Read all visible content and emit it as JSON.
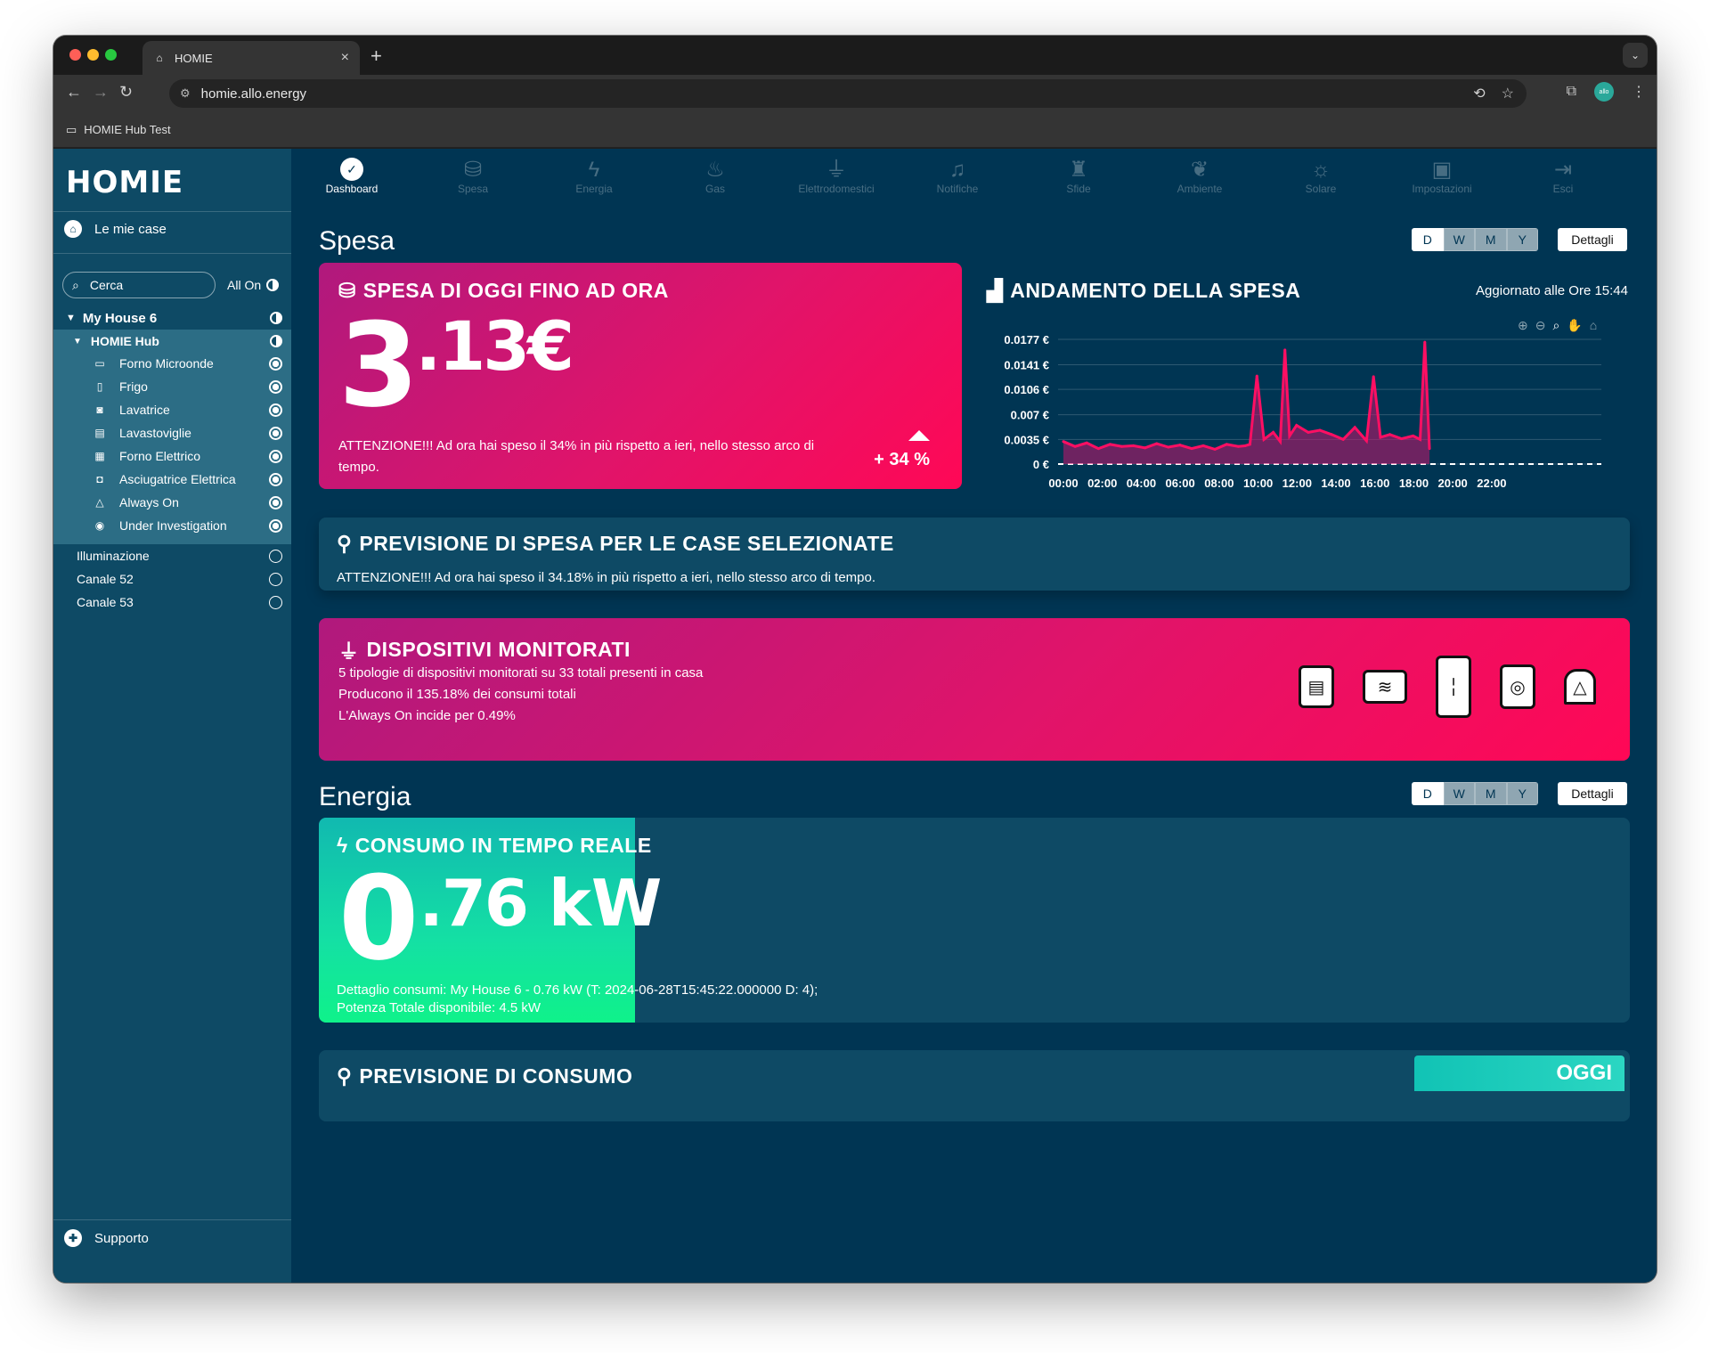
{
  "browser": {
    "tab_title": "HOMIE",
    "url": "homie.allo.energy",
    "bookmark": "HOMIE Hub Test",
    "avatar_text": "allo"
  },
  "sidebar": {
    "logo": "HOMIE",
    "home_label": "Le mie case",
    "search_placeholder": "Cerca",
    "all_on": "All On",
    "house": "My House 6",
    "hub": "HOMIE Hub",
    "devices": [
      {
        "label": "Forno Microonde",
        "icon": "microwave-icon"
      },
      {
        "label": "Frigo",
        "icon": "fridge-icon"
      },
      {
        "label": "Lavatrice",
        "icon": "washer-icon"
      },
      {
        "label": "Lavastoviglie",
        "icon": "dishwasher-icon"
      },
      {
        "label": "Forno Elettrico",
        "icon": "oven-icon"
      },
      {
        "label": "Asciugatrice Elettrica",
        "icon": "dryer-icon"
      },
      {
        "label": "Always On",
        "icon": "always-on-icon"
      },
      {
        "label": "Under Investigation",
        "icon": "eye-icon"
      }
    ],
    "channels": [
      "Illuminazione",
      "Canale 52",
      "Canale 53"
    ],
    "support": "Supporto"
  },
  "nav": [
    {
      "label": "Dashboard",
      "icon": "dashboard-icon"
    },
    {
      "label": "Spesa",
      "icon": "coins-icon"
    },
    {
      "label": "Energia",
      "icon": "bolt-icon"
    },
    {
      "label": "Gas",
      "icon": "flame-icon"
    },
    {
      "label": "Elettrodomestici",
      "icon": "plug-icon"
    },
    {
      "label": "Notifiche",
      "icon": "bell-icon"
    },
    {
      "label": "Sfide",
      "icon": "trophy-icon"
    },
    {
      "label": "Ambiente",
      "icon": "leaf-icon"
    },
    {
      "label": "Solare",
      "icon": "sun-icon"
    },
    {
      "label": "Impostazioni",
      "icon": "user-settings-icon"
    },
    {
      "label": "Esci",
      "icon": "logout-icon"
    }
  ],
  "periods": [
    "D",
    "W",
    "M",
    "Y"
  ],
  "dettagli": "Dettagli",
  "spesa": {
    "title": "Spesa",
    "today_card": {
      "title": "SPESA DI OGGI FINO AD ORA",
      "value_int": "3",
      "value_dec": ".13€",
      "warning": "ATTENZIONE!!! Ad ora hai speso il 34% in più rispetto a ieri, nello stesso arco di tempo.",
      "delta": "+ 34 %"
    },
    "trend": {
      "title": "ANDAMENTO DELLA SPESA",
      "updated": "Aggiornato alle Ore 15:44"
    },
    "forecast": {
      "title": "PREVISIONE DI SPESA PER LE CASE SELEZIONATE",
      "text": "ATTENZIONE!!! Ad ora hai speso il 34.18% in più rispetto a ieri, nello stesso arco di tempo."
    },
    "devices_card": {
      "title": "DISPOSITIVI MONITORATI",
      "lines": [
        "5 tipologie di dispositivi monitorati su 33 totali presenti in casa",
        "Producono il 135.18% dei consumi totali",
        "L'Always On incide per 0.49%"
      ]
    }
  },
  "energia": {
    "title": "Energia",
    "realtime": {
      "title": "CONSUMO IN TEMPO REALE",
      "value_int": "0",
      "value_dec": ".76",
      "unit": "kW",
      "detail": "Dettaglio consumi: My House 6 - 0.76 kW (T: 2024-06-28T15:45:22.000000 D: 4);",
      "power": "Potenza Totale disponibile: 4.5 kW",
      "gauge_fraction": 0.17
    },
    "forecast": {
      "title": "PREVISIONE DI CONSUMO",
      "badge": "OGGI"
    }
  },
  "chart_data": {
    "type": "area",
    "title": "ANDAMENTO DELLA SPESA",
    "x_ticks": [
      "00:00",
      "02:00",
      "04:00",
      "06:00",
      "08:00",
      "10:00",
      "12:00",
      "14:00",
      "16:00",
      "18:00",
      "20:00",
      "22:00"
    ],
    "y_ticks": [
      "0 €",
      "0.0035 €",
      "0.007 €",
      "0.0106 €",
      "0.0141 €",
      "0.0177 €"
    ],
    "ylim": [
      0,
      0.0177
    ],
    "xlim_hours": [
      0,
      24
    ],
    "x_hours": [
      0,
      0.5,
      1,
      1.5,
      2,
      2.5,
      3,
      3.5,
      4,
      4.5,
      5,
      5.5,
      6,
      6.5,
      7,
      7.5,
      7.8,
      8,
      8.3,
      8.6,
      9,
      9.3,
      9.5,
      9.7,
      10,
      10.5,
      11,
      11.5,
      12,
      12.5,
      13,
      13.3,
      13.6,
      14,
      14.5,
      15,
      15.3,
      15.5,
      15.7
    ],
    "series": [
      {
        "values": [
          0.0032,
          0.0025,
          0.003,
          0.0022,
          0.0028,
          0.0025,
          0.0026,
          0.0023,
          0.0029,
          0.0024,
          0.0027,
          0.0022,
          0.0026,
          0.0021,
          0.0028,
          0.0025,
          0.0026,
          0.0028,
          0.0125,
          0.0035,
          0.0045,
          0.0032,
          0.0162,
          0.004,
          0.0055,
          0.0045,
          0.0048,
          0.0042,
          0.0035,
          0.0052,
          0.0033,
          0.0124,
          0.0038,
          0.0042,
          0.0036,
          0.004,
          0.0035,
          0.0173,
          0.0022
        ]
      }
    ],
    "color": "#ff0f63"
  }
}
